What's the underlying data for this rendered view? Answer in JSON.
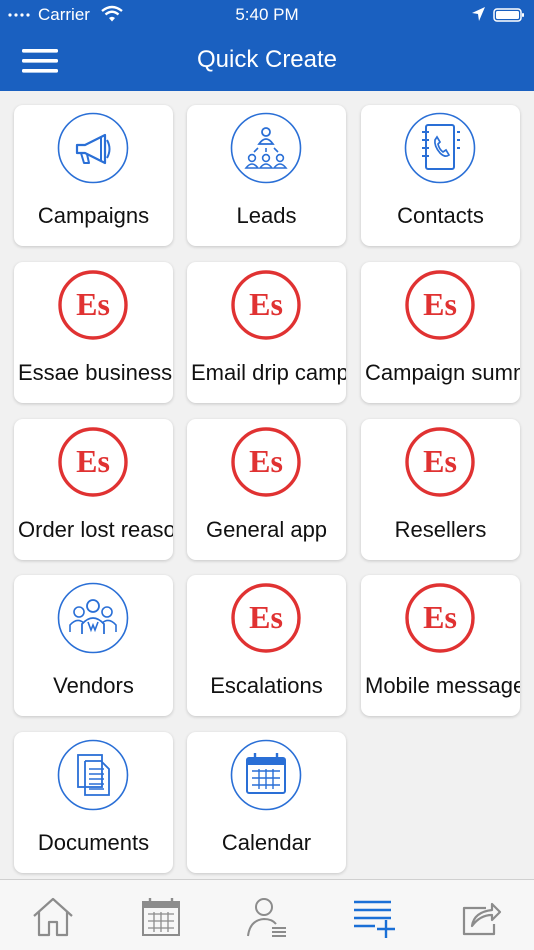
{
  "status": {
    "carrier": "Carrier",
    "time": "5:40 PM"
  },
  "nav": {
    "title": "Quick Create"
  },
  "colors": {
    "brand": "#1a60c0",
    "module_blue": "#2a6fd6",
    "es_red": "#e03232",
    "tab_active": "#1a6fd6",
    "tab_inactive": "#8c8c8c"
  },
  "tiles": [
    {
      "label": "Campaigns",
      "icon": "megaphone-icon"
    },
    {
      "label": "Leads",
      "icon": "people-hierarchy-icon"
    },
    {
      "label": "Contacts",
      "icon": "contact-book-icon"
    },
    {
      "label": "Essae business",
      "icon": "es-logo-icon"
    },
    {
      "label": "Email drip campaign",
      "icon": "es-logo-icon"
    },
    {
      "label": "Campaign summary",
      "icon": "es-logo-icon"
    },
    {
      "label": "Order lost reason",
      "icon": "es-logo-icon"
    },
    {
      "label": "General app",
      "icon": "es-logo-icon"
    },
    {
      "label": "Resellers",
      "icon": "es-logo-icon"
    },
    {
      "label": "Vendors",
      "icon": "vendor-group-icon"
    },
    {
      "label": "Escalations",
      "icon": "es-logo-icon"
    },
    {
      "label": "Mobile message",
      "icon": "es-logo-icon"
    },
    {
      "label": "Documents",
      "icon": "documents-icon"
    },
    {
      "label": "Calendar",
      "icon": "calendar-icon"
    }
  ],
  "es_logo_text": "Es",
  "tabs": [
    {
      "icon": "home-icon",
      "active": false
    },
    {
      "icon": "calendar-tab-icon",
      "active": false
    },
    {
      "icon": "profile-list-icon",
      "active": false
    },
    {
      "icon": "quick-create-icon",
      "active": true
    },
    {
      "icon": "share-icon",
      "active": false
    }
  ]
}
